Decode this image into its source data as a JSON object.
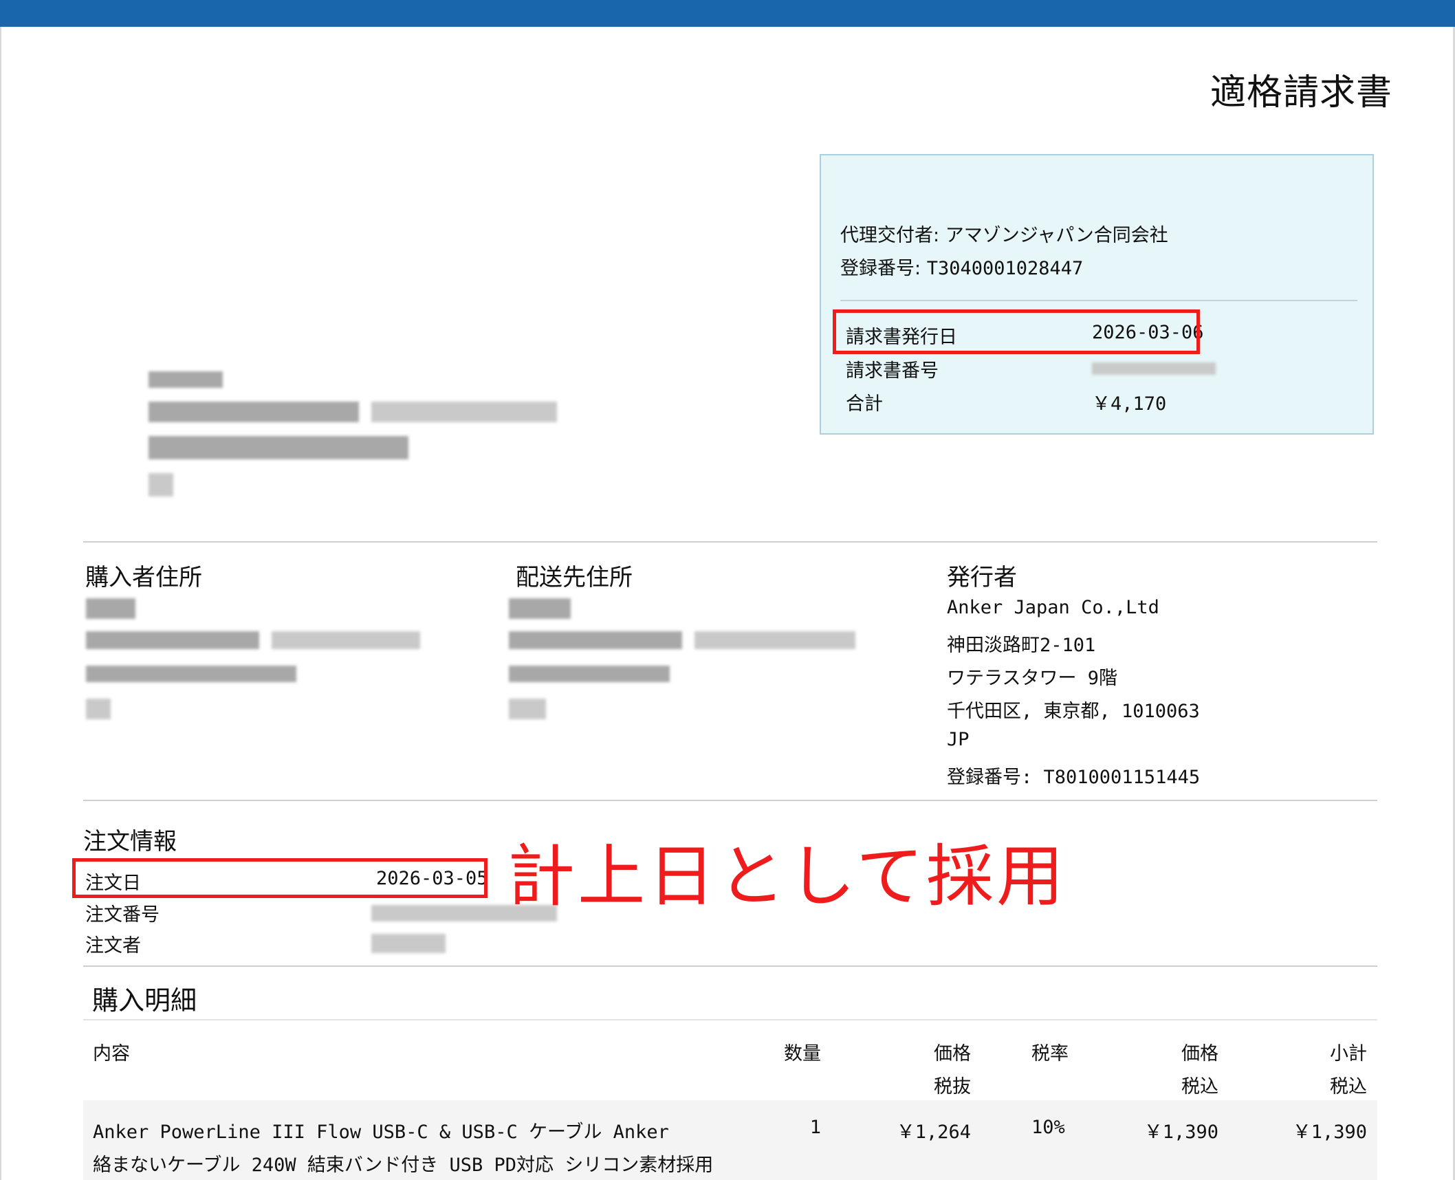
{
  "document": {
    "title": "適格請求書",
    "annotation": "計上日として採用"
  },
  "summary_box": {
    "agent_label": "代理交付者:",
    "agent_name": "アマゾンジャパン合同会社",
    "reg_label": "登録番号:",
    "reg_number": "T3040001028447",
    "issue_date_label": "請求書発行日",
    "issue_date": "2026-03-06",
    "invoice_number_label": "請求書番号",
    "total_label": "合計",
    "total": "￥4,170"
  },
  "addresses": {
    "buyer_heading": "購入者住所",
    "shipping_heading": "配送先住所",
    "issuer_heading": "発行者",
    "issuer_lines": [
      "Anker Japan Co.,Ltd",
      "神田淡路町2-101",
      "ワテラスタワー 9階",
      "千代田区, 東京都, 1010063",
      "JP",
      "登録番号: T8010001151445"
    ]
  },
  "order_info": {
    "heading": "注文情報",
    "order_date_label": "注文日",
    "order_date": "2026-03-05",
    "order_number_label": "注文番号",
    "orderer_label": "注文者"
  },
  "purchase_details": {
    "heading": "購入明細",
    "headers": {
      "description": "内容",
      "quantity": "数量",
      "price_excl_1": "価格",
      "price_excl_2": "税抜",
      "tax_rate": "税率",
      "price_incl_1": "価格",
      "price_incl_2": "税込",
      "subtotal_1": "小計",
      "subtotal_2": "税込"
    },
    "items": [
      {
        "description_line1": "Anker PowerLine III Flow USB-C & USB-C ケーブル Anker",
        "description_line2": "絡まないケーブル 240W 結束バンド付き USB PD対応 シリコン素材採用",
        "quantity": "1",
        "price_excl_tax": "￥1,264",
        "tax_rate": "10%",
        "price_incl_tax": "￥1,390",
        "subtotal_incl_tax": "￥1,390"
      }
    ]
  },
  "colors": {
    "header_bar": "#1a66ad",
    "info_box_bg": "#e7f6f8",
    "info_box_border": "#a9cfe0",
    "highlight_red": "#ee1c1c"
  }
}
